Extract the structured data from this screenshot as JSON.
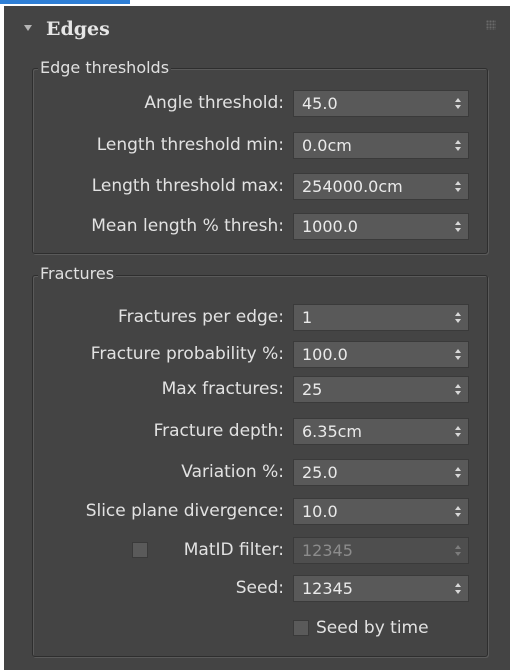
{
  "colors": {
    "panel_bg": "#444444",
    "field_bg": "#595959",
    "text": "#e2e2e2",
    "disabled_text": "#8c8c8c",
    "top_strip": "#2f7fd6"
  },
  "header": {
    "title": "Edges",
    "collapse_icon": "triangle-down-icon",
    "grip_icon": "drag-grip-icon"
  },
  "edge_thresholds": {
    "title": "Edge thresholds",
    "rows": [
      {
        "label": "Angle threshold:",
        "value": "45.0"
      },
      {
        "label": "Length threshold min:",
        "value": "0.0cm"
      },
      {
        "label": "Length threshold max:",
        "value": "254000.0cm"
      },
      {
        "label": "Mean length % thresh:",
        "value": "1000.0"
      }
    ]
  },
  "fractures": {
    "title": "Fractures",
    "rows": [
      {
        "label": "Fractures per edge:",
        "value": "1"
      },
      {
        "label": "Fracture probability %:",
        "value": "100.0"
      },
      {
        "label": "Max fractures:",
        "value": "25"
      },
      {
        "label": "Fracture depth:",
        "value": "6.35cm"
      },
      {
        "label": "Variation %:",
        "value": "25.0"
      },
      {
        "label": "Slice plane divergence:",
        "value": "10.0"
      }
    ],
    "matid_filter": {
      "label": "MatID filter:",
      "value": "12345",
      "checked": false,
      "enabled": false
    },
    "seed": {
      "label": "Seed:",
      "value": "12345"
    },
    "seed_by_time": {
      "label": "Seed by time",
      "checked": false
    }
  }
}
